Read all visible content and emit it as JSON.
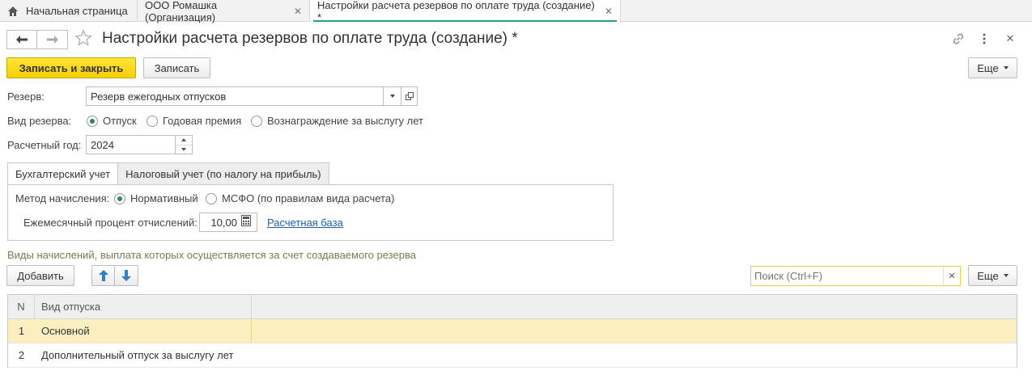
{
  "tabs": [
    {
      "label": "Начальная страница",
      "home": true
    },
    {
      "label": "ООО Ромашка (Организация)",
      "closable": true
    },
    {
      "label": "Настройки расчета резервов по оплате труда (создание) *",
      "closable": true,
      "active": true
    }
  ],
  "page": {
    "title": "Настройки расчета резервов по оплате труда (создание) *"
  },
  "toolbar": {
    "save_close": "Записать и закрыть",
    "save": "Записать",
    "more": "Еще"
  },
  "form": {
    "reserve_label": "Резерв:",
    "reserve_value": "Резерв ежегодных отпусков",
    "kind_label": "Вид резерва:",
    "kind_options": [
      "Отпуск",
      "Годовая премия",
      "Вознаграждение за выслугу лет"
    ],
    "kind_selected": "Отпуск",
    "year_label": "Расчетный год:",
    "year_value": "2024"
  },
  "subtabs": [
    "Бухгалтерский учет",
    "Налоговый учет (по налогу на прибыль)"
  ],
  "accounting": {
    "method_label": "Метод начисления:",
    "method_options": [
      "Нормативный",
      "МСФО (по правилам вида расчета)"
    ],
    "method_selected": "Нормативный",
    "percent_label": "Ежемесячный процент отчислений:",
    "percent_value": "10,00",
    "base_link": "Расчетная база"
  },
  "section": {
    "title": "Виды начислений, выплата которых осуществляется за счет создаваемого резерва",
    "add": "Добавить",
    "search_placeholder": "Поиск (Ctrl+F)",
    "more": "Еще"
  },
  "table": {
    "columns": [
      "N",
      "Вид отпуска"
    ],
    "rows": [
      {
        "n": "1",
        "value": "Основной"
      },
      {
        "n": "2",
        "value": "Дополнительный отпуск за выслугу лет"
      }
    ]
  }
}
